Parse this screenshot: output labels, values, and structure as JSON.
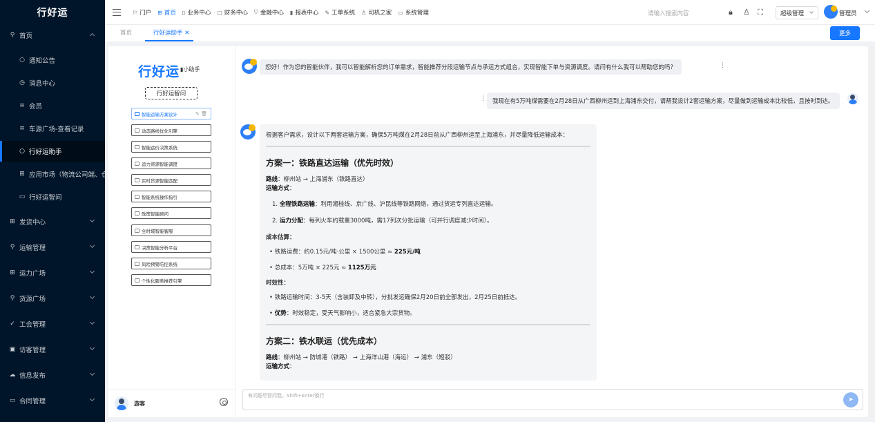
{
  "brand": "行好运",
  "sidebar": {
    "items": [
      {
        "label": "首页",
        "icon": "location-icon"
      },
      {
        "label": "通知公告",
        "icon": "circle-icon"
      },
      {
        "label": "消息中心",
        "icon": "message-icon"
      },
      {
        "label": "会员",
        "icon": "list-icon"
      },
      {
        "label": "车源广场-查看记录",
        "icon": "list-icon"
      },
      {
        "label": "行好运助手",
        "icon": "circle-icon"
      },
      {
        "label": "应用市场（物流公司端、仓",
        "icon": "grid-icon"
      },
      {
        "label": "行好运智问",
        "icon": "window-icon"
      },
      {
        "label": "发货中心",
        "icon": "grid-icon"
      },
      {
        "label": "运输管理",
        "icon": "location-icon"
      },
      {
        "label": "运力广场",
        "icon": "grid-icon"
      },
      {
        "label": "货源广场",
        "icon": "search-icon"
      },
      {
        "label": "工会管理",
        "icon": "check-icon"
      },
      {
        "label": "访客管理",
        "icon": "screen-icon"
      },
      {
        "label": "信息发布",
        "icon": "cloud-icon"
      },
      {
        "label": "合同管理",
        "icon": "window-icon"
      }
    ]
  },
  "topnav": {
    "items": [
      {
        "label": "门户",
        "icon": "flag-icon"
      },
      {
        "label": "首页",
        "icon": "grid-icon"
      },
      {
        "label": "业务中心",
        "icon": "page-icon"
      },
      {
        "label": "财务中心",
        "icon": "doc-icon"
      },
      {
        "label": "金融中心",
        "icon": "shield-icon"
      },
      {
        "label": "报表中心",
        "icon": "bar-chart-icon"
      },
      {
        "label": "工单系统",
        "icon": "wrench-icon"
      },
      {
        "label": "司机之家",
        "icon": "user-icon"
      },
      {
        "label": "系统管理",
        "icon": "monitor-icon"
      }
    ],
    "search_placeholder": "请输入搜索内容",
    "role": "超级管理",
    "user": "管理员"
  },
  "tabs": {
    "home": "首页",
    "current": "行好运助手",
    "more": "更多"
  },
  "assistant": {
    "logo": "行好运",
    "logo_sub": "小助手",
    "new_btn": "行好运智问",
    "items": [
      "智能运输方案设计",
      "动态路线优化引擎",
      "智能运价决策系统",
      "运力资源智能调度",
      "实时货源智能匹配",
      "智能系统操作指引",
      "政策智能顾问",
      "全时域智能客服",
      "决策智能分析平台",
      "风险预警防控系统",
      "个性化服务推荐引擎"
    ],
    "guest": "游客"
  },
  "chat": {
    "greeting": "您好！作为您的智能伙伴，我可以智能解析您的订单需求，智能推荐分段运输节点与承运方式组合，实现智能下单与资源调度。请问有什么我可以帮助您的吗？",
    "user_msg": "我现在有5万吨煤需要在2月28日从广西柳州运到上海浦东交付，请帮我设计2套运输方案，尽量做到运输成本比较低，且按时到达。",
    "reply": {
      "intro": "根据客户需求，设计以下两套运输方案，确保5万吨煤在2月28日前从广西柳州运至上海浦东，并尽量降低运输成本：",
      "plan1_title": "方案一：铁路直达运输（优先时效）",
      "route_label": "路线",
      "plan1_route": "：柳州站 → 上海浦东（铁路直达）",
      "method_label": "运输方式",
      "colon": "：",
      "p1_item1_num": "1. ",
      "p1_item1_bold": "全程铁路运输",
      "p1_item1_text": "：利用湘桂线、京广线、沪昆线等铁路网络，通过货运专列直达运输。",
      "p1_item2_num": "2. ",
      "p1_item2_bold": "运力分配",
      "p1_item2_text": "：每列火车约载重3000吨，需17列次分批运输（可并行调度减少时间）。",
      "cost_label": "成本估算",
      "cost1_pre": "铁路运费：约0.15元/吨·公里 × 1500公里 ≈ ",
      "cost1_bold": "225元/吨",
      "cost2_pre": "总成本：5万吨 × 225元 ≈ ",
      "cost2_bold": "1125万元",
      "time_label": "时效性",
      "time1": "铁路运输时间：3-5天（含装卸及中转），分批发运确保2月20日前全部发出，2月25日前抵达。",
      "adv_bold": "优势",
      "adv_text": "：时效稳定，受天气影响小，适合紧急大宗货物。",
      "plan2_title": "方案二：铁水联运（优先成本）",
      "plan2_route": "：柳州站 → 防城港（铁路） → 上海洋山港（海运） → 浦东（短驳）"
    },
    "input_placeholder": "有问题尽管问我，Shift+Enter换行"
  }
}
